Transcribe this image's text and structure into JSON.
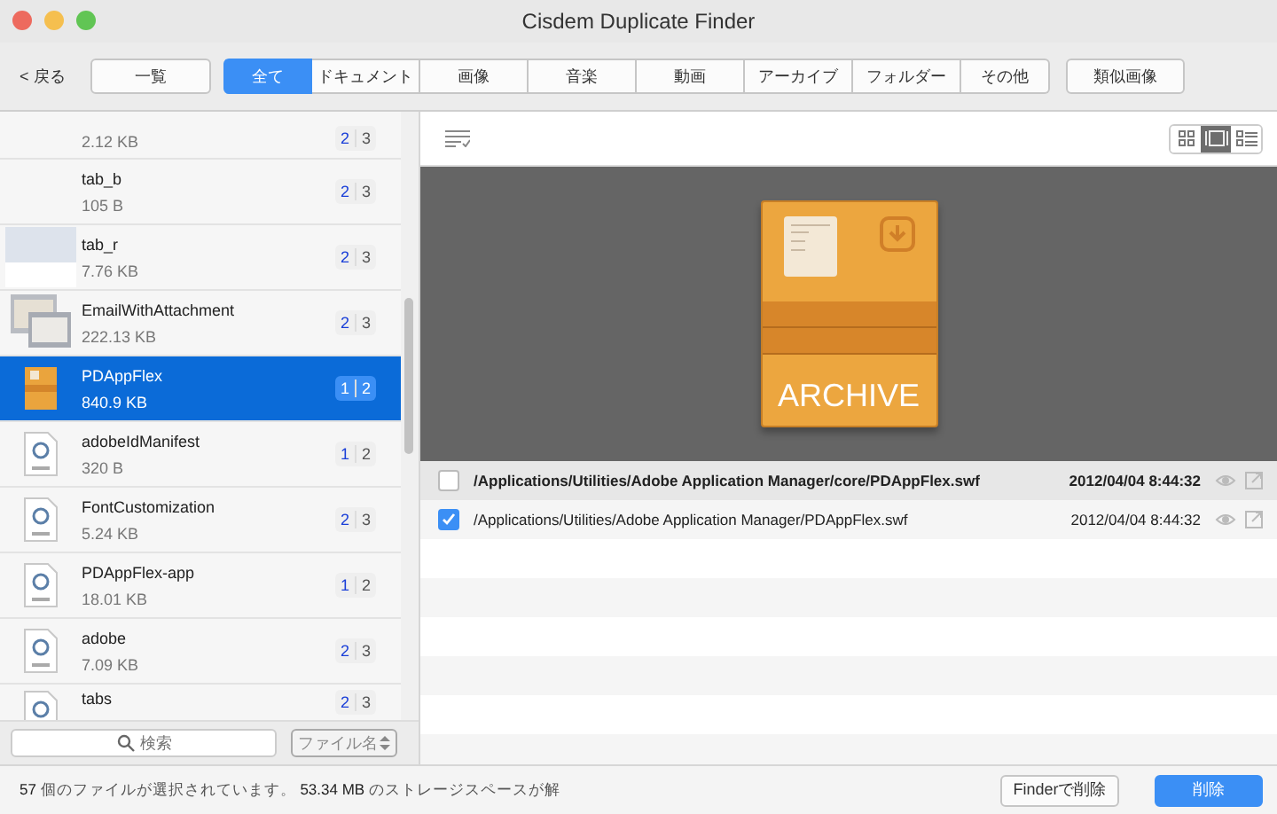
{
  "window": {
    "title": "Cisdem Duplicate Finder"
  },
  "toolbar": {
    "back": "< 戻る",
    "list_button": "一覧",
    "tabs": [
      {
        "label": "全て",
        "selected": true
      },
      {
        "label": "ドキュメント",
        "selected": false
      },
      {
        "label": "画像",
        "selected": false
      },
      {
        "label": "音楽",
        "selected": false
      },
      {
        "label": "動画",
        "selected": false
      },
      {
        "label": "アーカイブ",
        "selected": false
      },
      {
        "label": "フォルダー",
        "selected": false
      },
      {
        "label": "その他",
        "selected": false
      }
    ],
    "similar_button": "類似画像"
  },
  "sidebar": {
    "items": [
      {
        "kind": "blank",
        "size": "2.12 KB",
        "count_a": "2",
        "count_b": "3",
        "selected": false
      },
      {
        "kind": "blank",
        "name": "tab_b",
        "size": "105 B",
        "count_a": "2",
        "count_b": "3",
        "selected": false
      },
      {
        "kind": "image",
        "name": "tab_r",
        "size": "7.76 KB",
        "count_a": "2",
        "count_b": "3",
        "selected": false
      },
      {
        "kind": "screenshot",
        "name": "EmailWithAttachment",
        "size": "222.13 KB",
        "count_a": "2",
        "count_b": "3",
        "selected": false
      },
      {
        "kind": "archive",
        "name": "PDAppFlex",
        "size": "840.9 KB",
        "count_a": "1",
        "count_b": "2",
        "selected": true
      },
      {
        "kind": "text",
        "name": "adobeIdManifest",
        "size": "320 B",
        "count_a": "1",
        "count_b": "2",
        "selected": false
      },
      {
        "kind": "text",
        "name": "FontCustomization",
        "size": "5.24 KB",
        "count_a": "2",
        "count_b": "3",
        "selected": false
      },
      {
        "kind": "text",
        "name": "PDAppFlex-app",
        "size": "18.01 KB",
        "count_a": "1",
        "count_b": "2",
        "selected": false
      },
      {
        "kind": "text",
        "name": "adobe",
        "size": "7.09 KB",
        "count_a": "2",
        "count_b": "3",
        "selected": false
      },
      {
        "kind": "text",
        "name": "tabs",
        "count_a": "2",
        "count_b": "3",
        "selected": false
      }
    ],
    "search": {
      "placeholder": "検索"
    },
    "sort": "ファイル名"
  },
  "preview": {
    "label": "ARCHIVE",
    "views": [
      {
        "kind": "grid",
        "selected": false
      },
      {
        "kind": "filmstrip",
        "selected": true
      },
      {
        "kind": "list",
        "selected": false
      }
    ]
  },
  "files": [
    {
      "path": "/Applications/Utilities/Adobe Application Manager/core/PDAppFlex.swf",
      "date": "2012/04/04 8:44:32",
      "checked": false,
      "bold": true
    },
    {
      "path": "/Applications/Utilities/Adobe Application Manager/PDAppFlex.swf",
      "date": "2012/04/04 8:44:32",
      "checked": true,
      "bold": false
    }
  ],
  "status_bar": {
    "text": "**57** 個のファイルが選択されています。 **53.34 MB** のストレージスペースが解",
    "finder_button": "Finderで削除",
    "delete_button": "削除"
  }
}
